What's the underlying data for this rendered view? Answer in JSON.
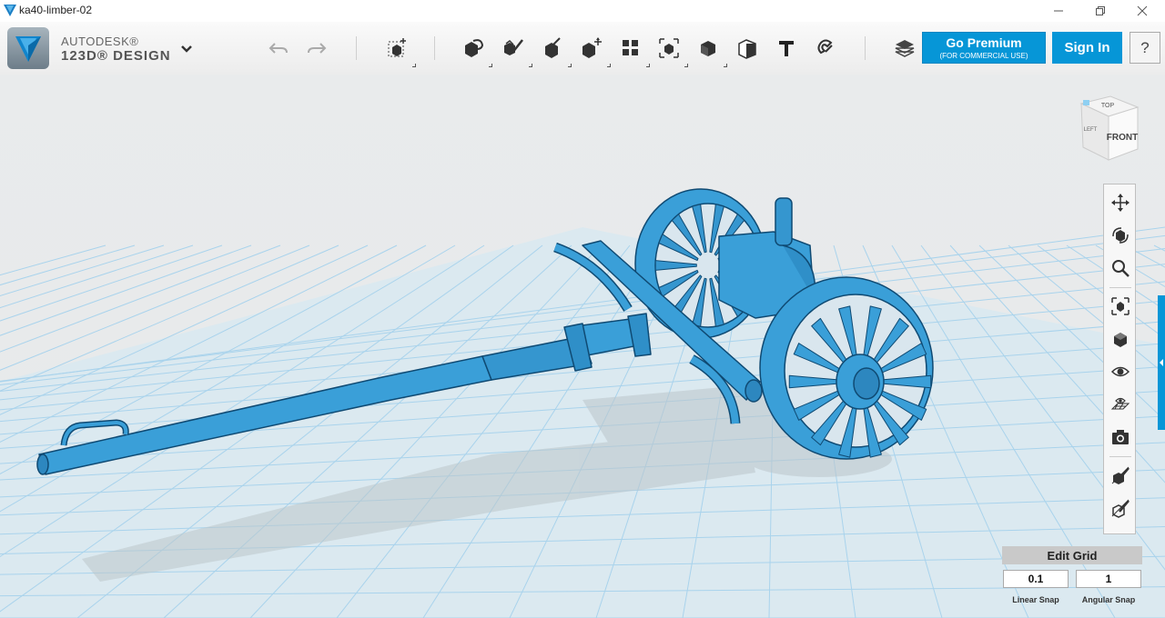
{
  "window": {
    "title": "ka40-limber-02",
    "controls": [
      "minimize-icon",
      "restore-icon",
      "close-icon"
    ]
  },
  "brand": {
    "line1": "AUTODESK®",
    "line2": "123D® DESIGN"
  },
  "toolbar": {
    "icons": [
      "undo-icon",
      "redo-icon",
      "primitives-icon",
      "sketch-icon",
      "construct-icon",
      "modify-icon",
      "pattern-icon",
      "grouping-icon",
      "combine-icon",
      "measure-icon",
      "text-icon",
      "snap-icon",
      "material-icon"
    ],
    "go_premium_label": "Go Premium",
    "go_premium_sub": "(FOR COMMERCIAL USE)",
    "sign_in_label": "Sign In",
    "help_label": "?"
  },
  "view_cube": {
    "top": "TOP",
    "front": "FRONT",
    "left": "LEFT"
  },
  "nav_bar": {
    "icons": [
      "pan-icon",
      "orbit-icon",
      "zoom-icon",
      "fit-icon",
      "perspective-icon",
      "visibility-icon",
      "grid-visibility-icon",
      "screenshot-icon",
      "material-render-icon",
      "outline-icon"
    ]
  },
  "grid_panel": {
    "edit_grid_label": "Edit Grid",
    "linear_snap_value": "0.1",
    "angular_snap_value": "1",
    "linear_snap_label": "Linear Snap",
    "angular_snap_label": "Angular Snap"
  },
  "colors": {
    "accent": "#0696d7",
    "model": "#3a9fd8",
    "model_edge": "#0f4a73",
    "grid": "#9fd0ec",
    "viewport_bg": "#e8ebec"
  }
}
